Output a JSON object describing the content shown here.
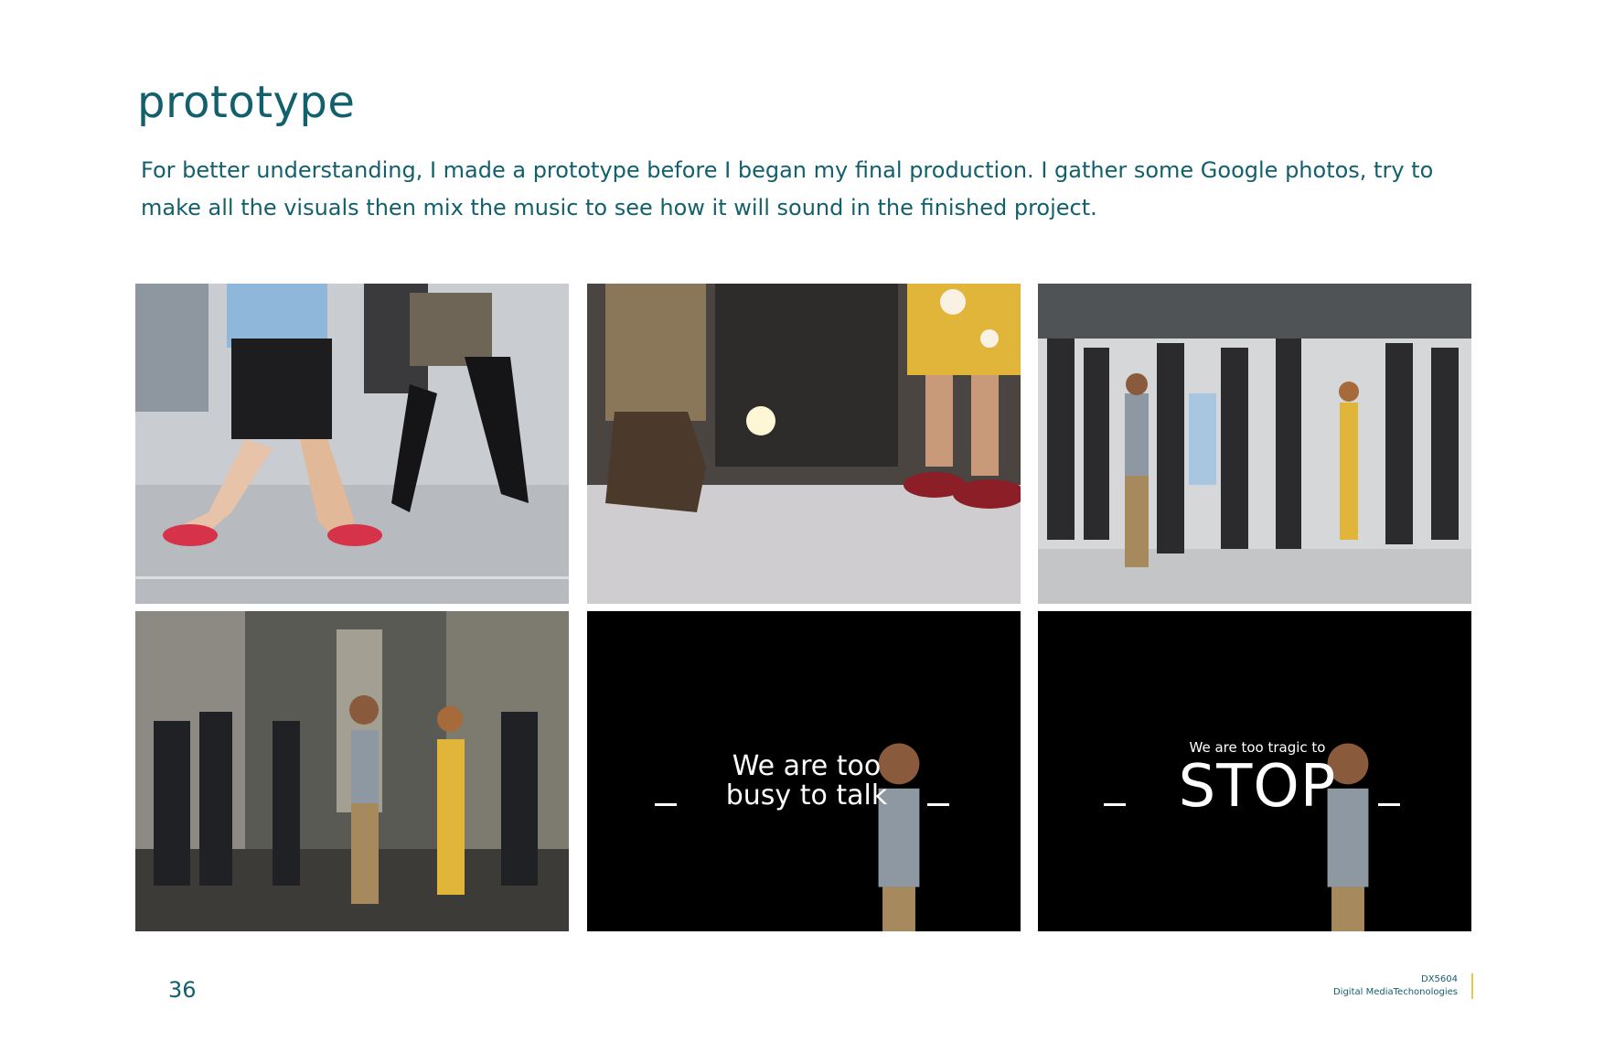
{
  "page": {
    "title": "prototype",
    "intro": "For better understanding, I made a prototype before I began my final production. I gather some Google photos, try to make all the visuals  then mix the music to see how it will sound in the finished project."
  },
  "slides": {
    "slide5_text_line1": "We are too",
    "slide5_text_line2": "busy to talk",
    "slide6_small": "We are too tragic to",
    "slide6_big": "STOP"
  },
  "footer": {
    "page_number": "36",
    "course_code": "DX5604",
    "course_name": "Digital MediaTechonologies"
  },
  "colors": {
    "accent": "#13606d",
    "footer_bar": "#e8c94a"
  }
}
